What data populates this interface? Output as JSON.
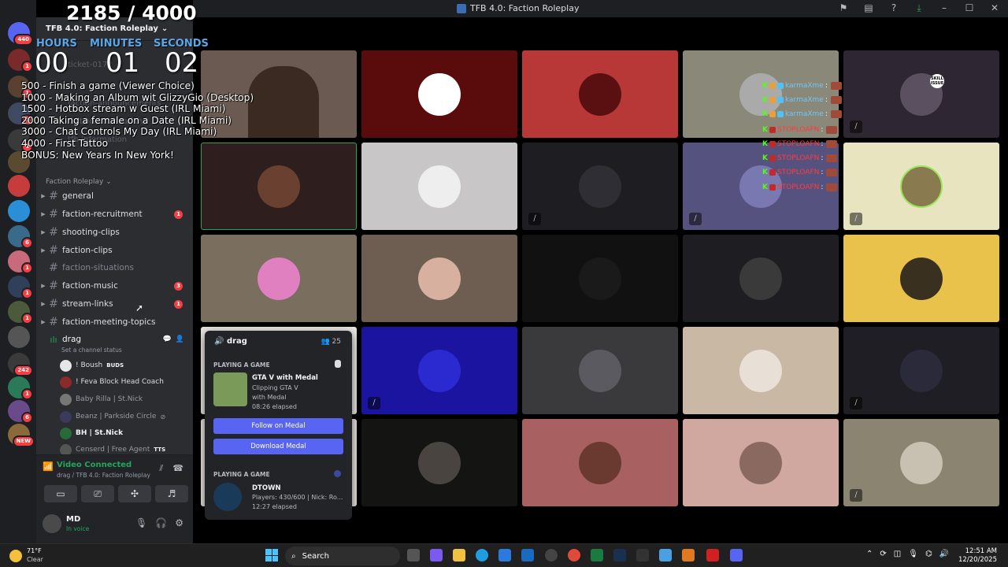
{
  "window": {
    "title": "TFB 4.0: Faction Roleplay"
  },
  "overlay": {
    "count": "2185 / 4000",
    "units": {
      "hours": "HOURS",
      "minutes": "MINUTES",
      "seconds": "SECONDS"
    },
    "timer": {
      "hours": "00",
      "minutes": "01",
      "seconds": "02"
    },
    "goals": [
      "500 - Finish a game (Viewer Choice)",
      "1000 - Making an Album wit GlizzyGio (Desktop)",
      "1500 - Hotbox stream w Guest (IRL Miami)",
      "2000 Taking a female on a Date (IRL Miami)",
      "3000 - Chat Controls My Day (IRL Miami)",
      "4000 - First Tattoo",
      "BONUS: New Years In New York!"
    ]
  },
  "rail": {
    "badges": [
      "440",
      "1",
      "1",
      "1",
      "1",
      "6",
      "6",
      "1",
      "1",
      "1",
      "242",
      "1",
      "6",
      "NEW"
    ]
  },
  "sidebar": {
    "server_name": "TFB 4.0: Faction Roleplay",
    "hidden_channels": [
      "ticket-0172",
      "faction-announcements",
      "faction-information",
      "tfb-information"
    ],
    "category": "Faction Roleplay",
    "channels": [
      {
        "name": "general",
        "badge": ""
      },
      {
        "name": "faction-recruitment",
        "badge": "1"
      },
      {
        "name": "shooting-clips",
        "badge": ""
      },
      {
        "name": "faction-clips",
        "badge": ""
      },
      {
        "name": "faction-situations",
        "badge": ""
      },
      {
        "name": "faction-music",
        "badge": "3"
      },
      {
        "name": "stream-links",
        "badge": "1"
      },
      {
        "name": "faction-meeting-topics",
        "badge": ""
      }
    ],
    "voice_channel": {
      "name": "drag",
      "status": "Set a channel status"
    },
    "voice_users": [
      "! Boush",
      "! Feva Block Head Coach",
      "Baby Rilla | St.Nick",
      "Beanz | Parkside Circle",
      "BH | St.Nick",
      "Censerd | Free Agent"
    ],
    "voice_user_tags": {
      "boush_tag": "BUDS",
      "censerd_tag": "TTS"
    }
  },
  "voice_panel": {
    "status": "Video Connected",
    "location": "drag / TFB 4.0: Faction Roleplay"
  },
  "user_panel": {
    "name": "MD",
    "status": "In voice"
  },
  "popout": {
    "channel": "drag",
    "count": "25",
    "game1": {
      "label": "PLAYING A GAME",
      "title": "GTA V with Medal",
      "line1": "Clipping GTA V",
      "line2": "with Medal",
      "elapsed": "08:26 elapsed",
      "button1": "Follow on Medal",
      "button2": "Download Medal"
    },
    "game2": {
      "label": "PLAYING A GAME",
      "title": "DTOWN",
      "line1": "Players: 430/600 | Nick: Ro...",
      "elapsed": "12:27 elapsed"
    }
  },
  "chat": [
    {
      "user": "karmaXme",
      "suffix": ":"
    },
    {
      "user": "karmaXme",
      "suffix": ":"
    },
    {
      "user": "karmaXme",
      "suffix": ":"
    },
    {
      "user": "STOPLOAFN",
      "suffix": ":"
    },
    {
      "user": "STOPLOAFN",
      "suffix": ":"
    },
    {
      "user": "STOPLOAFN",
      "suffix": ":"
    },
    {
      "user": "STOPLOAFN",
      "suffix": ":"
    },
    {
      "user": "STOPLOAFN",
      "suffix": ":"
    }
  ],
  "tile_labels": {
    "skill_issue": "SKILL ISSUE"
  },
  "taskbar": {
    "temp": "71°F",
    "weather": "Clear",
    "search": "Search",
    "time": "12:51 AM",
    "date": "12/20/2025"
  },
  "colors": {
    "discord_blurple": "#5865f2",
    "connected_green": "#23a55a",
    "notification_red": "#f23f43",
    "timer_blue": "#5aa7e8"
  }
}
